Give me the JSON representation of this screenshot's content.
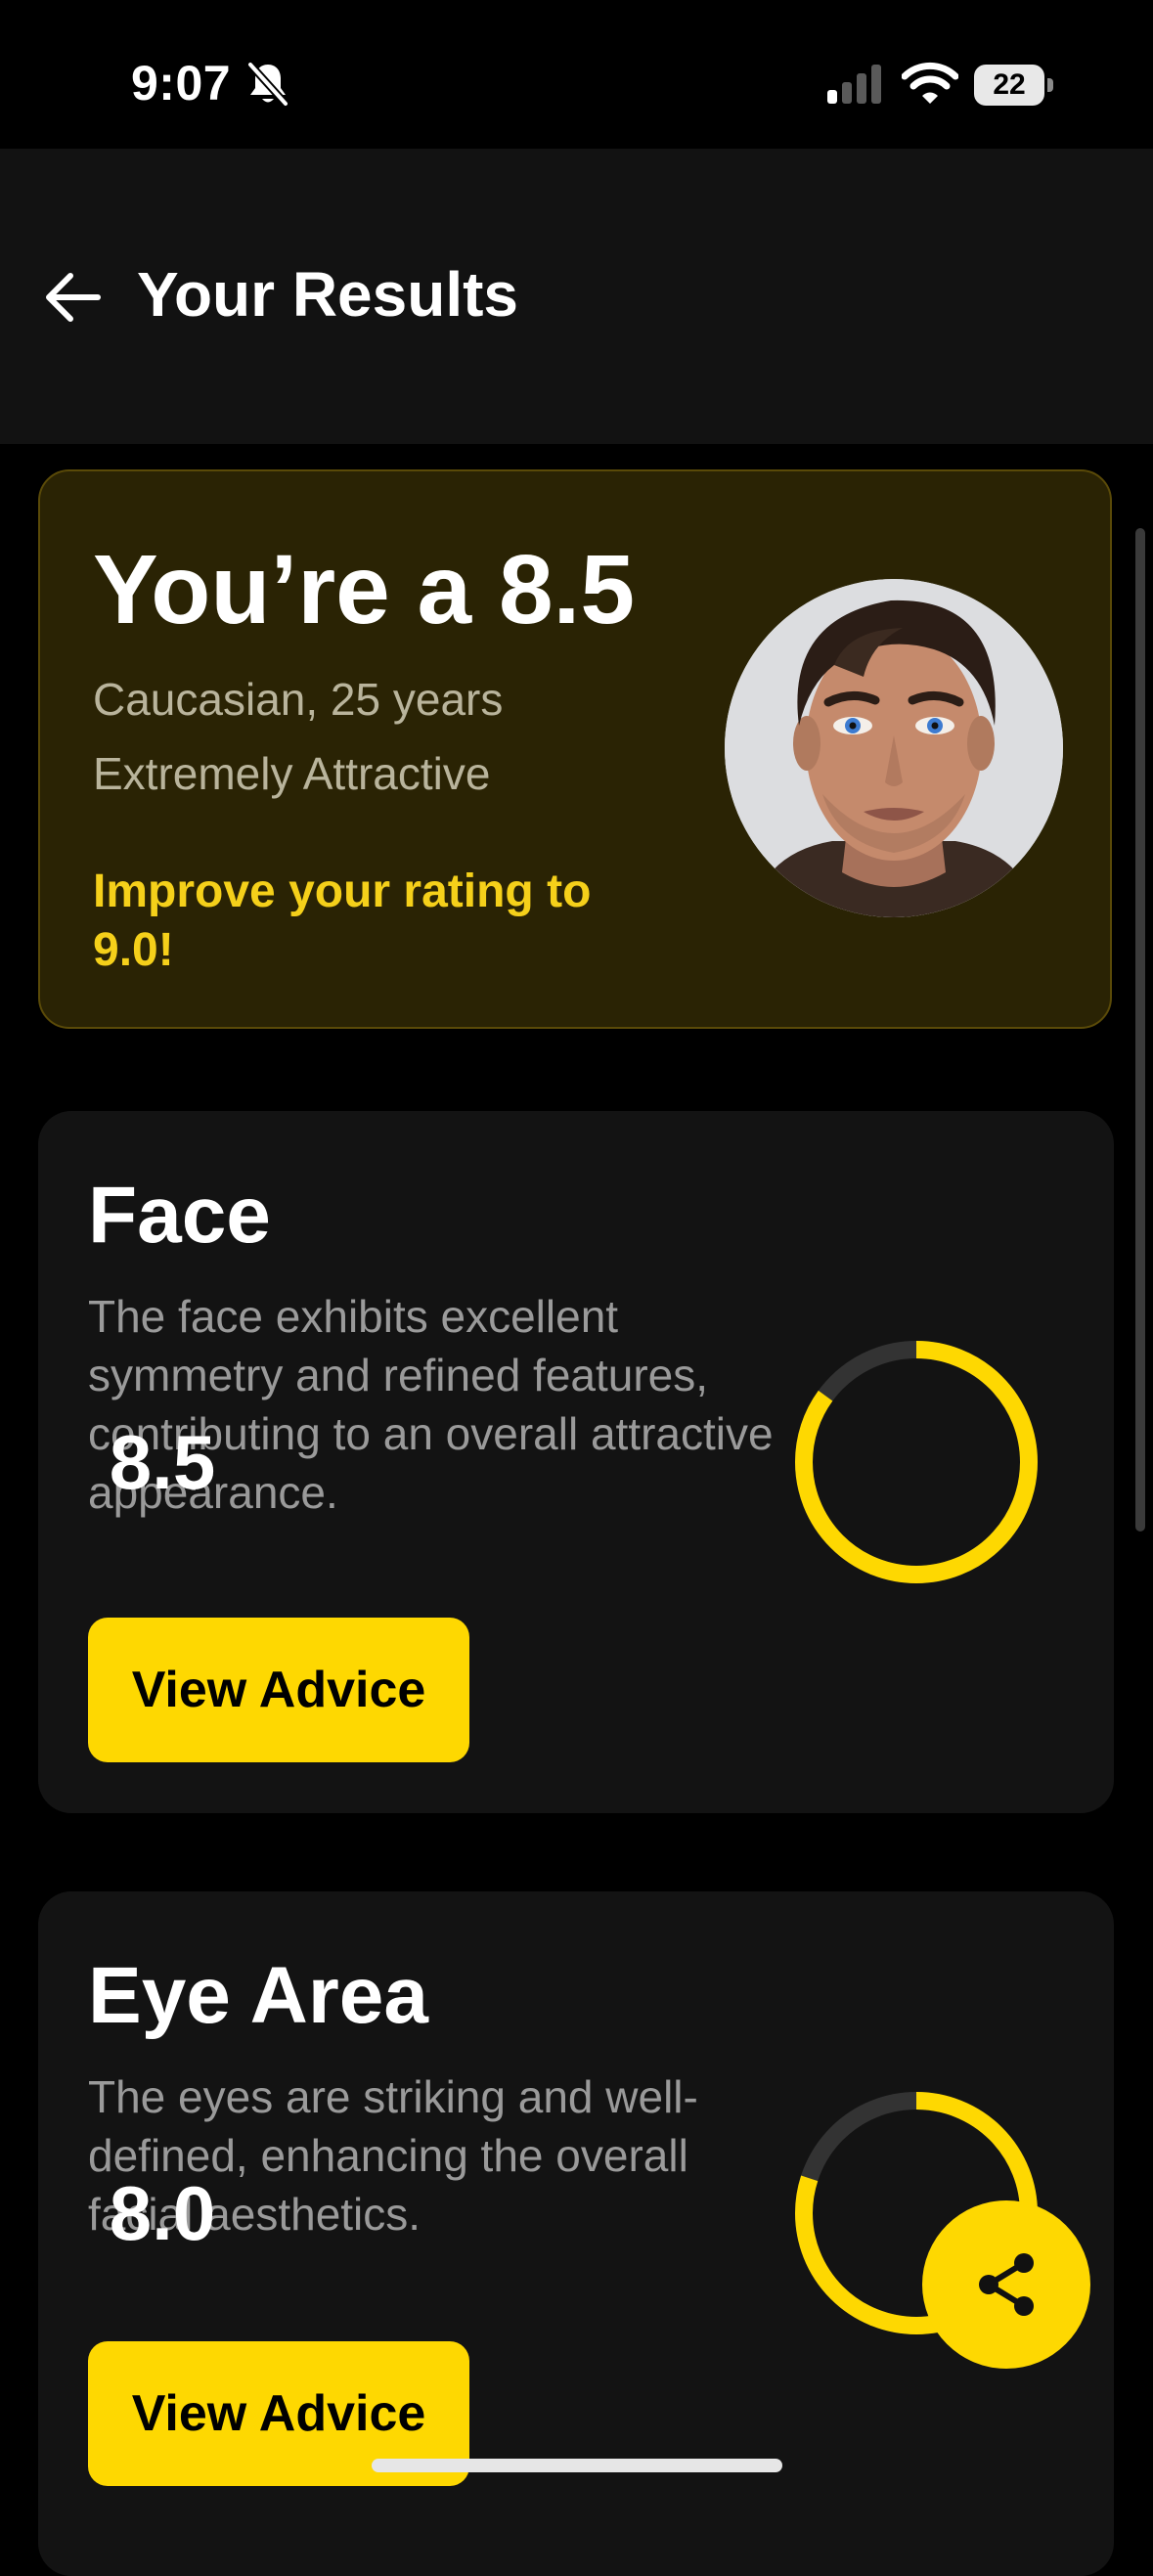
{
  "status_bar": {
    "time": "9:07",
    "battery": "22",
    "icons": [
      "bell-off-icon",
      "signal-icon",
      "wifi-icon",
      "battery-icon"
    ]
  },
  "header": {
    "title": "Your Results",
    "back_icon": "arrow-left-icon"
  },
  "hero": {
    "score_text": "You’re a 8.5",
    "subtitle_1": "Caucasian, 25 years",
    "subtitle_2": "Extremely Attractive",
    "cta": "Improve your rating to 9.0!",
    "avatar_icon": "user-portrait-avatar"
  },
  "metrics": [
    {
      "title": "Face",
      "description": "The face exhibits excellent symmetry and refined features, contributing to an overall attractive appearance.",
      "score_label": "8.5",
      "score": 8.5,
      "max_score": 10,
      "button_label": "View Advice"
    },
    {
      "title": "Eye Area",
      "description": "The eyes are striking and well-defined, enhancing the overall facial aesthetics.",
      "score_label": "8.0",
      "score": 8.0,
      "max_score": 10,
      "button_label": "View Advice"
    }
  ],
  "share_icon": "share-icon",
  "colors": {
    "accent": "#fed801",
    "accent_text": "#f5d01a",
    "background": "#000000",
    "card": "#131313",
    "hero_card": "#2a2304",
    "ring_track": "#333333"
  }
}
